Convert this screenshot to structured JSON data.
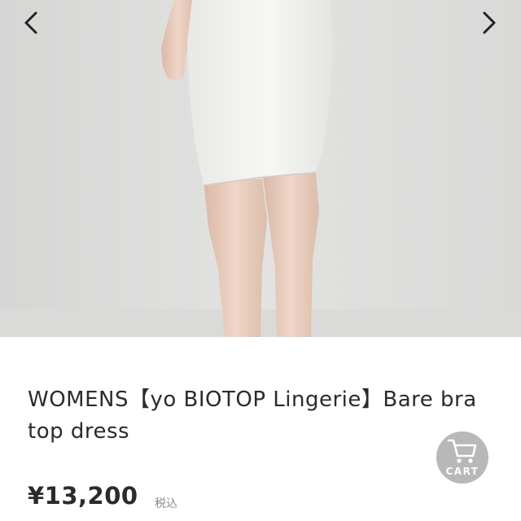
{
  "gallery": {
    "image_alt": "Model wearing white bra top dress (lower body view)",
    "prev_icon": "chevron-left-icon",
    "next_icon": "chevron-right-icon"
  },
  "product": {
    "title": "WOMENS【yo BIOTOP Lingerie】Bare bra top dress",
    "price": "¥13,200",
    "tax_label": "税込"
  },
  "cart": {
    "label": "CART",
    "icon": "cart-icon"
  },
  "colors": {
    "background": "#ffffff",
    "text": "#2b2b2b",
    "muted": "#8a8a8a",
    "cart_button": "#b8b8b8"
  }
}
